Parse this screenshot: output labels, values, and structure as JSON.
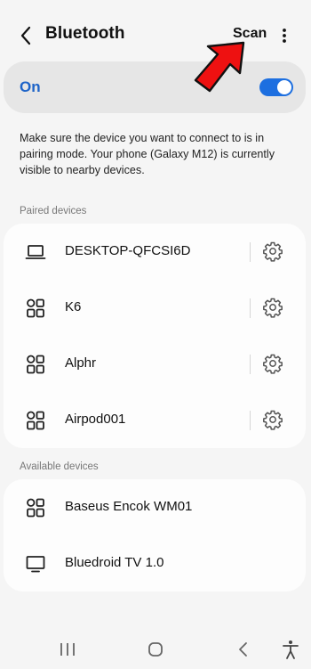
{
  "header": {
    "title": "Bluetooth",
    "scan_label": "Scan"
  },
  "bluetooth_toggle": {
    "label": "On",
    "state": "on",
    "accent_color": "#1d6fe0"
  },
  "info_text": "Make sure the device you want to connect to is in pairing mode. Your phone (Galaxy M12) is currently visible to nearby devices.",
  "paired": {
    "section_label": "Paired devices",
    "devices": [
      {
        "name": "DESKTOP-QFCSI6D",
        "icon": "laptop-icon"
      },
      {
        "name": "K6",
        "icon": "generic-device-icon"
      },
      {
        "name": "Alphr",
        "icon": "generic-device-icon"
      },
      {
        "name": "Airpod001",
        "icon": "generic-device-icon"
      }
    ]
  },
  "available": {
    "section_label": "Available devices",
    "devices": [
      {
        "name": "Baseus Encok WM01",
        "icon": "generic-device-icon"
      },
      {
        "name": "Bluedroid TV 1.0",
        "icon": "tv-icon"
      }
    ]
  },
  "annotation": {
    "color": "#ee1111",
    "icon": "red-pointer-arrow"
  }
}
